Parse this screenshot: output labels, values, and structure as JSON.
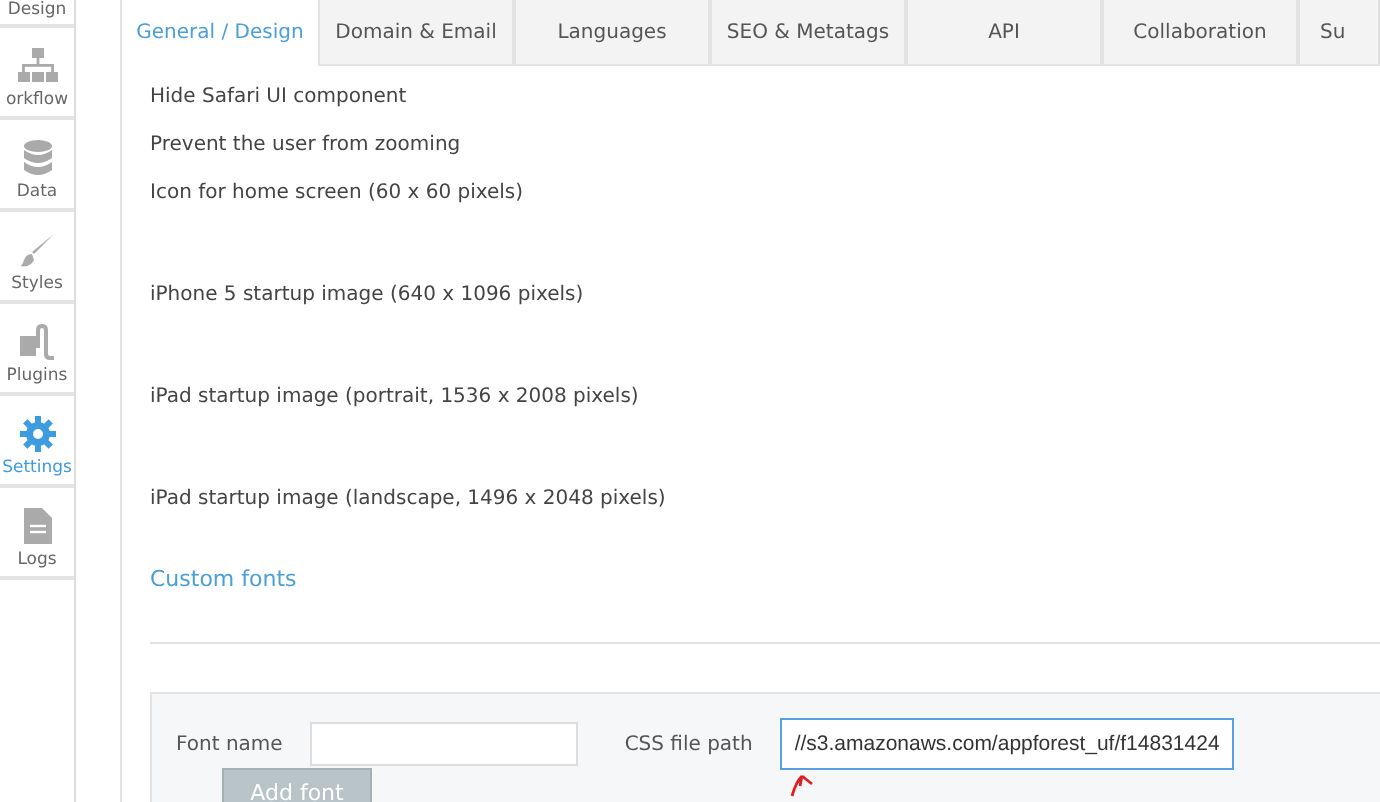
{
  "sidebar": {
    "items": [
      {
        "label": "Design",
        "kind": "plain",
        "selected": false
      },
      {
        "label": "orkflow",
        "kind": "workflow",
        "selected": false
      },
      {
        "label": "Data",
        "kind": "data",
        "selected": false
      },
      {
        "label": "Styles",
        "kind": "styles",
        "selected": false
      },
      {
        "label": "Plugins",
        "kind": "plugins",
        "selected": false
      },
      {
        "label": "Settings",
        "kind": "settings",
        "selected": true
      },
      {
        "label": "Logs",
        "kind": "logs",
        "selected": false
      }
    ]
  },
  "tabs": [
    {
      "label": "General / Design",
      "selected": true
    },
    {
      "label": "Domain & Email",
      "selected": false
    },
    {
      "label": "Languages",
      "selected": false
    },
    {
      "label": "SEO & Metatags",
      "selected": false
    },
    {
      "label": "API",
      "selected": false
    },
    {
      "label": "Collaboration",
      "selected": false
    },
    {
      "label": "Su",
      "selected": false
    }
  ],
  "settings": [
    {
      "label": "Hide Safari UI component",
      "kind": "short"
    },
    {
      "label": "Prevent the user from zooming",
      "kind": "short"
    },
    {
      "label": "Icon for home screen (60 x 60 pixels)",
      "kind": "tall"
    },
    {
      "label": "iPhone 5 startup image (640 x 1096 pixels)",
      "kind": "tall"
    },
    {
      "label": "iPad startup image (portrait, 1536 x 2008 pixels)",
      "kind": "tall"
    },
    {
      "label": "iPad startup image (landscape, 1496 x 2048 pixels)",
      "kind": "tall"
    }
  ],
  "custom_fonts": {
    "heading": "Custom fonts",
    "font_name_label": "Font name",
    "css_path_label": "CSS file path",
    "css_path_value": "//s3.amazonaws.com/appforest_uf/f14831424",
    "add_button": "Add font"
  }
}
